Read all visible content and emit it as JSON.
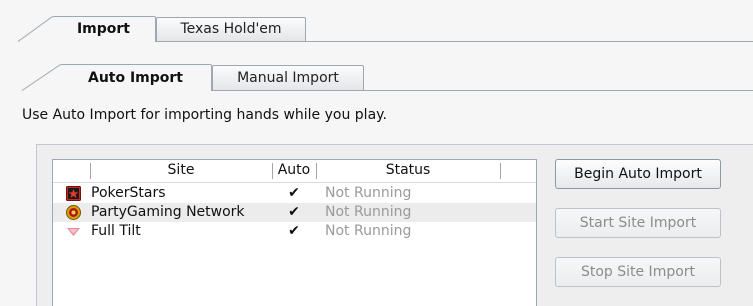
{
  "tabs_top": [
    {
      "label": "Import",
      "active": true
    },
    {
      "label": "Texas Hold'em",
      "active": false
    }
  ],
  "tabs_sub": [
    {
      "label": "Auto Import",
      "active": true
    },
    {
      "label": "Manual Import",
      "active": false
    }
  ],
  "description": "Use Auto Import for importing hands while you play.",
  "list": {
    "columns": [
      "Site",
      "Auto",
      "Status"
    ],
    "rows": [
      {
        "icon": "pokerstars-icon",
        "site": "PokerStars",
        "auto": "✔",
        "status": "Not Running"
      },
      {
        "icon": "partygaming-icon",
        "site": "PartyGaming Network",
        "auto": "✔",
        "status": "Not Running"
      },
      {
        "icon": "fulltilt-icon",
        "site": "Full Tilt",
        "auto": "✔",
        "status": "Not Running"
      }
    ]
  },
  "buttons": {
    "begin": "Begin Auto Import",
    "start_site": "Start Site Import",
    "stop_site": "Stop Site Import"
  },
  "colors": {
    "tab_border": "#9ea7b3",
    "status_text": "#9a9a9a",
    "disabled_text": "#8c8c8c"
  }
}
